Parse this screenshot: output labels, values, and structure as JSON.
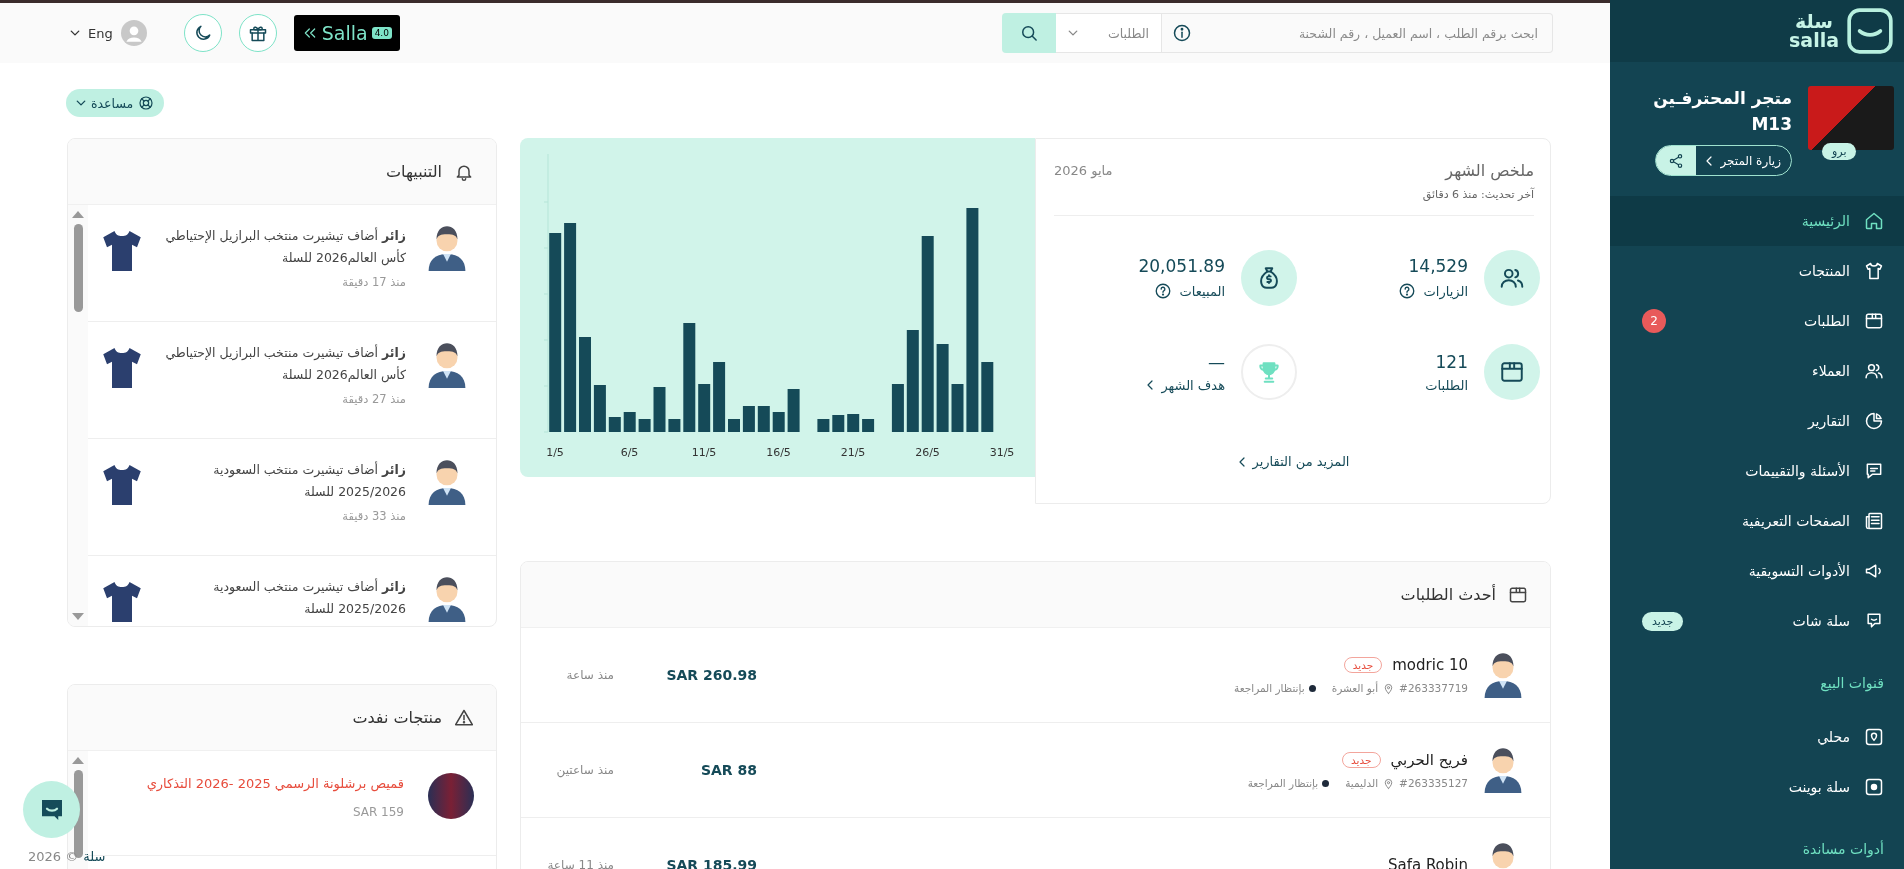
{
  "sidebar": {
    "brand": {
      "arabic": "سلة",
      "latin": "salla"
    },
    "store": {
      "name": "متجر المحترفـين M13",
      "plan_badge": "برو",
      "visit_button": "زيارة المتجر"
    },
    "nav": [
      {
        "label": "الرئيسية",
        "selected": true
      },
      {
        "label": "المنتجات",
        "selected": false
      },
      {
        "label": "الطلبات",
        "selected": false,
        "badge": {
          "text": "2",
          "kind": "count"
        }
      },
      {
        "label": "العملاء",
        "selected": false
      },
      {
        "label": "التقارير",
        "selected": false
      },
      {
        "label": "الأسئلة والتقييمات",
        "selected": false
      },
      {
        "label": "الصفحات التعريفية",
        "selected": false
      },
      {
        "label": "الأدوات التسويقية",
        "selected": false
      },
      {
        "label": "سلة شات",
        "selected": false,
        "badge": {
          "text": "جديد",
          "kind": "new"
        }
      }
    ],
    "sections": [
      {
        "title": "قنوات البيع",
        "items": [
          {
            "label": "محلي",
            "selected": false
          },
          {
            "label": "سلة بوينت",
            "selected": false
          }
        ]
      },
      {
        "title": "أدوات مساندة"
      }
    ]
  },
  "top_bar": {
    "search": {
      "placeholder": "ابحث برقم الطلب ، اسم العميل ، رقم الشحنة",
      "scope": "الطلبات"
    },
    "version_badge": {
      "name": "Salla",
      "version": "4.0"
    },
    "language": "Eng"
  },
  "help": {
    "label": "مساعدة"
  },
  "summary": {
    "title": "ملخص الشهر",
    "period": "مايو 2026",
    "updated": "آخر تحديث: منذ 6 دقائق",
    "stats": [
      {
        "value": "14,529",
        "label": "الزيارات",
        "kind": "info"
      },
      {
        "value": "20,051.89",
        "label": "المبيعات",
        "kind": "info"
      },
      {
        "value": "121",
        "label": "الطلبات",
        "kind": "plain"
      },
      {
        "value": "—",
        "label": "هدف الشهر",
        "kind": "link"
      }
    ],
    "more_link": "المزيد من التقارير",
    "chart": {
      "x_labels": [
        "31/5",
        "26/5",
        "21/5",
        "16/5",
        "11/5",
        "6/5",
        "1/5"
      ]
    }
  },
  "orders": {
    "title": "أحدث الطلبات",
    "rows": [
      {
        "customer": "modric 10",
        "new_badge": "جديد",
        "order_no": "#263337719",
        "location": "أبو العشرة",
        "status": "بإنتظار المراجعة",
        "amount": "SAR 260.98",
        "time": "منذ ساعة"
      },
      {
        "customer": "فريح الحربي",
        "new_badge": "جديد",
        "order_no": "#263335127",
        "location": "الدليمية",
        "status": "بإنتظار المراجعة",
        "amount": "SAR 88",
        "time": "منذ ساعتين"
      },
      {
        "customer": "Safa Robin",
        "amount": "SAR 185.99",
        "time": "منذ 11 ساعة"
      }
    ]
  },
  "notifications": {
    "title": "التنبيهات",
    "items": [
      {
        "text": "**زائر** أضاف تيشيرت منتخب البرازيل الإحتياطي كأس العالم2026 للسلة",
        "time": "منذ 17 دقيقة"
      },
      {
        "text": "**زائر** أضاف تيشيرت منتخب البرازيل الإحتياطي كأس العالم2026 للسلة",
        "time": "منذ 27 دقيقة"
      },
      {
        "text": "**زائر** أضاف تيشيرت منتخب السعودية 2025/2026 للسلة",
        "time": "منذ 33 دقيقة"
      },
      {
        "text": "**زائر** أضاف تيشيرت منتخب السعودية 2025/2026 للسلة"
      }
    ]
  },
  "out_of_stock": {
    "title": "منتجات نفدت",
    "items": [
      {
        "name": "قميص برشلونة الرسمي 2025 -2026 التذكاري",
        "price": "SAR 159"
      }
    ]
  },
  "footer": {
    "brand": "سلة",
    "copyright": "© 2026"
  }
}
